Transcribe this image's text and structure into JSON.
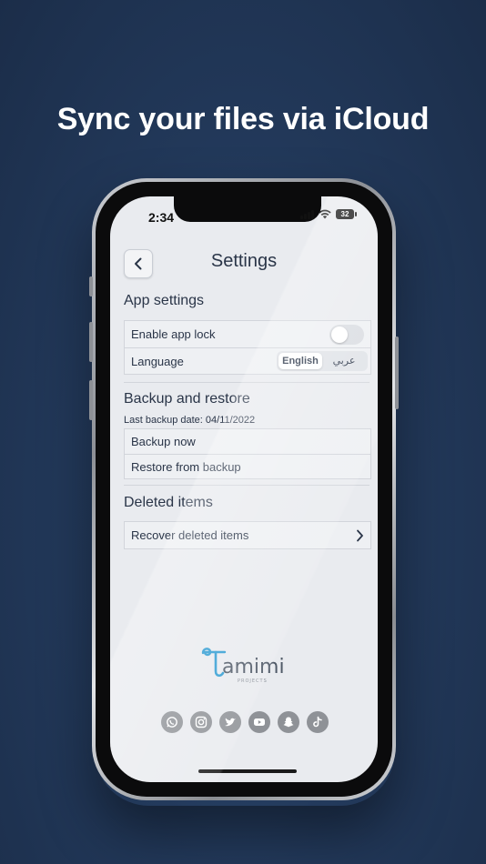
{
  "headline": "Sync your files via iCloud",
  "status": {
    "time": "2:34",
    "battery": "32"
  },
  "nav": {
    "title": "Settings"
  },
  "app_settings": {
    "title": "App settings",
    "app_lock_label": "Enable app lock",
    "app_lock_enabled": false,
    "language_label": "Language",
    "language_options": [
      "English",
      "عربي"
    ],
    "language_selected": "English"
  },
  "backup": {
    "title": "Backup and restore",
    "last_backup": "Last backup date: 04/11/2022",
    "backup_now": "Backup now",
    "restore": "Restore from backup"
  },
  "deleted": {
    "title": "Deleted items",
    "recover": "Recover deleted items"
  },
  "brand": {
    "logo_text": "amimi",
    "logo_sub": "PROJECTS",
    "accent": "#2d9bd2"
  },
  "socials": [
    "whatsapp-icon",
    "instagram-icon",
    "twitter-icon",
    "youtube-icon",
    "snapchat-icon",
    "tiktok-icon"
  ]
}
